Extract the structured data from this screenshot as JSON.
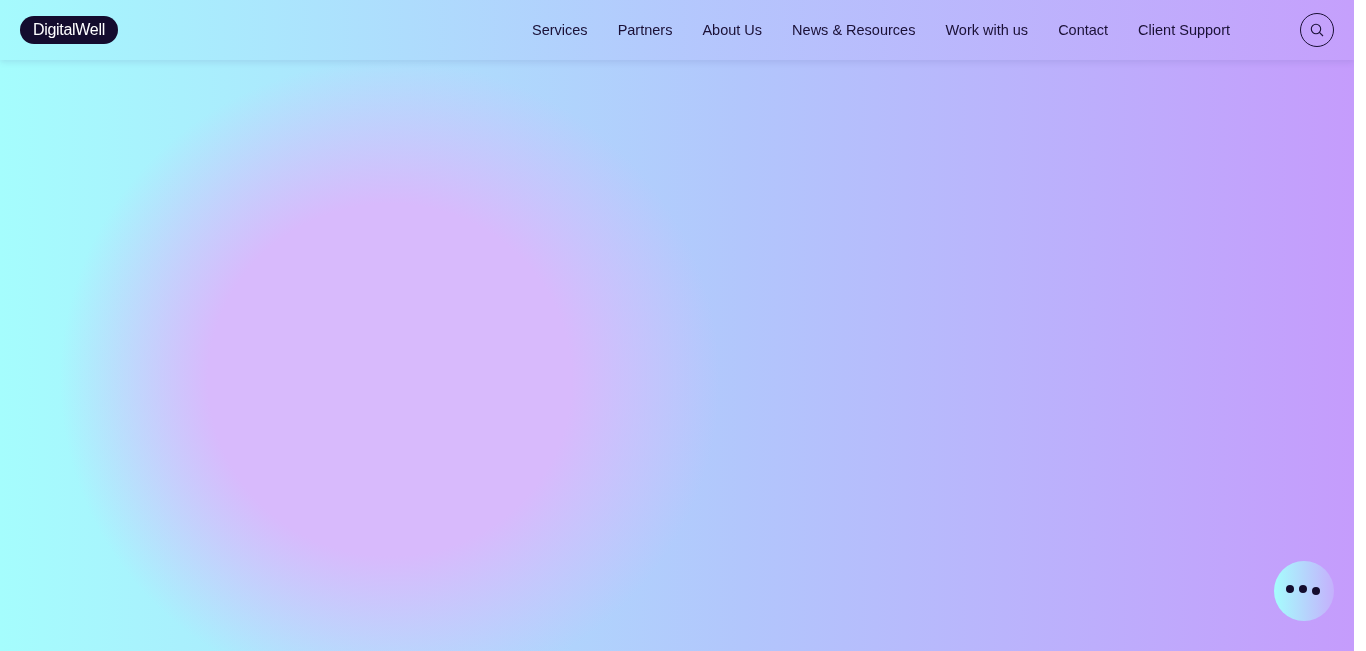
{
  "header": {
    "logo": "DigitalWell",
    "nav": [
      {
        "label": "Services"
      },
      {
        "label": "Partners"
      },
      {
        "label": "About Us"
      },
      {
        "label": "News & Resources"
      },
      {
        "label": "Work with us"
      },
      {
        "label": "Contact"
      },
      {
        "label": "Client Support"
      }
    ]
  }
}
